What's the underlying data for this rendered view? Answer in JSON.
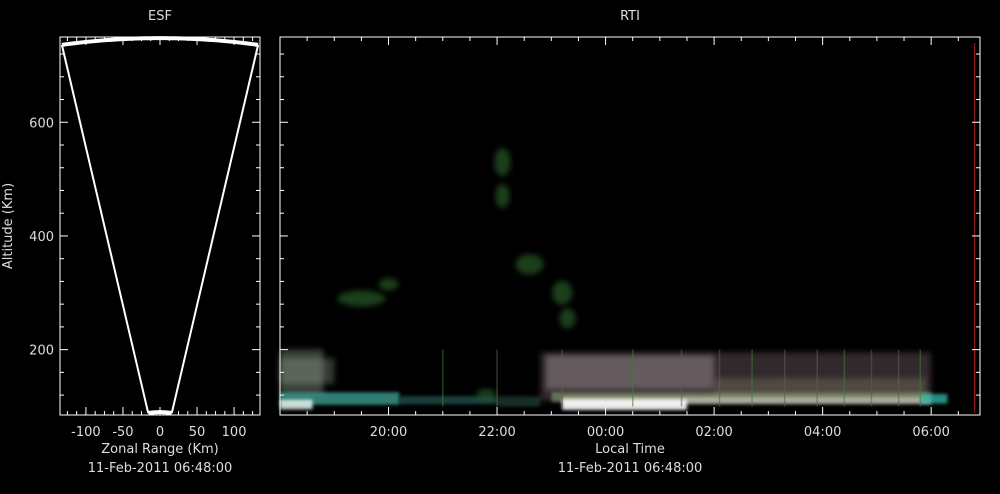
{
  "colors": {
    "background": "#000000",
    "axis": "#ffffff",
    "text": "#dddddd",
    "red_line": "#8b1a1a"
  },
  "chart_data": [
    {
      "type": "sector-outline",
      "title": "ESF",
      "xlabel": "Zonal Range (Km)",
      "ylabel": "Altitude (Km)",
      "timestamp": "11-Feb-2011 06:48:00",
      "xlim": [
        -135,
        135
      ],
      "ylim": [
        85,
        750
      ],
      "xticks": [
        -100,
        -50,
        0,
        50,
        100
      ],
      "xtick_labels": [
        "-100",
        "-50",
        "0",
        "50",
        "100"
      ],
      "yticks": [
        200,
        400,
        600
      ],
      "ytick_labels": [
        "200",
        "400",
        "600"
      ],
      "sector": {
        "half_angle_deg": 10.2,
        "inner_radius": 90,
        "outer_radius": 748
      },
      "grid": false
    },
    {
      "type": "heatmap",
      "title": "RTI",
      "xlabel": "Local Time",
      "ylabel": "Altitude (Km)",
      "timestamp": "11-Feb-2011 06:48:00",
      "xlim": [
        18.0,
        30.9
      ],
      "ylim": [
        85,
        750
      ],
      "xticks": [
        20,
        22,
        24,
        26,
        28,
        30
      ],
      "xtick_labels": [
        "20:00",
        "22:00",
        "00:00",
        "02:00",
        "04:00",
        "06:00"
      ],
      "yticks": [
        200,
        400,
        600
      ],
      "marker_time": 30.8,
      "grid": false
    }
  ]
}
